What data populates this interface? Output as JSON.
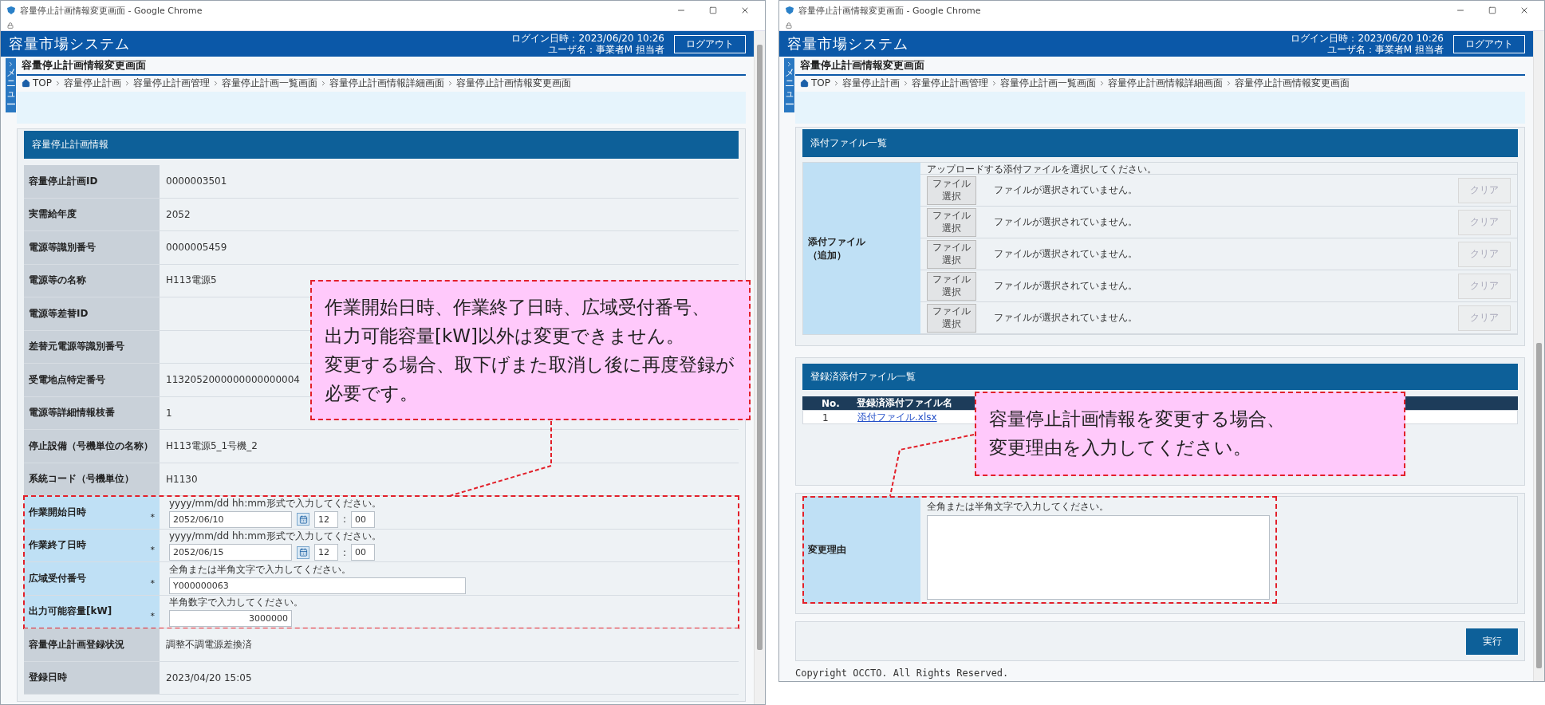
{
  "windows": [
    {
      "title": "容量停止計画情報変更画面 - Google Chrome",
      "app_name": "容量市場システム",
      "login_time": "ログイン日時：2023/06/20 10:26",
      "user_name": "ユーザ名：事業者M 担当者",
      "logout": "ログアウト",
      "menu_tab": "メニュー",
      "page_title": "容量停止計画情報変更画面",
      "breadcrumb": [
        "TOP",
        "容量停止計画",
        "容量停止計画管理",
        "容量停止計画一覧画面",
        "容量停止計画情報詳細画面",
        "容量停止計画情報変更画面"
      ],
      "sections": [
        {
          "kind": "details",
          "title": "容量停止計画情報",
          "rows": [
            {
              "kind": "text",
              "label": "容量停止計画ID",
              "value": "0000003501",
              "highlighted": false
            },
            {
              "kind": "text",
              "label": "実需給年度",
              "value": "2052",
              "highlighted": false
            },
            {
              "kind": "text",
              "label": "電源等識別番号",
              "value": "0000005459",
              "highlighted": false
            },
            {
              "kind": "text",
              "label": "電源等の名称",
              "value": "H113電源5",
              "highlighted": false
            },
            {
              "kind": "text",
              "label": "電源等差替ID",
              "highlighted": false
            },
            {
              "kind": "text",
              "label": "差替元電源等識別番号",
              "highlighted": false
            },
            {
              "kind": "text",
              "label": "受電地点特定番号",
              "value": "1132052000000000000004",
              "highlighted": false
            },
            {
              "kind": "text",
              "label": "電源等詳細情報枝番",
              "value": "1",
              "highlighted": false
            },
            {
              "kind": "text",
              "label": "停止設備（号機単位の名称）",
              "value": "H113電源5_1号機_2",
              "highlighted": false
            },
            {
              "kind": "text",
              "label": "系統コード（号機単位）",
              "value": "H1130",
              "highlighted": false
            },
            {
              "kind": "datetime",
              "label": "作業開始日時",
              "mark": "*",
              "hint": "yyyy/mm/dd hh:mm形式で入力してください。",
              "date": "2052/06/10",
              "hour": "12",
              "time_separator": ":",
              "minute": "00",
              "highlighted": true
            },
            {
              "kind": "datetime",
              "label": "作業終了日時",
              "mark": "*",
              "hint": "yyyy/mm/dd hh:mm形式で入力してください。",
              "date": "2052/06/15",
              "hour": "12",
              "time_separator": ":",
              "minute": "00",
              "highlighted": true
            },
            {
              "kind": "text_input",
              "label": "広域受付番号",
              "mark": "*",
              "hint": "全角または半角文字で入力してください。",
              "value": "Y000000063",
              "highlighted": true
            },
            {
              "kind": "number_input",
              "label": "出力可能容量[kW]",
              "mark": "*",
              "hint": "半角数字で入力してください。",
              "value": "3000000",
              "highlighted": true
            },
            {
              "kind": "text",
              "label": "容量停止計画登録状況",
              "value": "調整不調電源差換済",
              "highlighted": false
            },
            {
              "kind": "text",
              "label": "登録日時",
              "value": "2023/04/20 15:05",
              "highlighted": false
            }
          ]
        }
      ],
      "callout": [
        "作業開始日時、作業終了日時、広域受付番号、",
        "出力可能容量[kW]以外は変更できません。",
        "変更する場合、取下げまた取消し後に再度登録が",
        "必要です。"
      ]
    },
    {
      "title": "容量停止計画情報変更画面 - Google Chrome",
      "app_name": "容量市場システム",
      "login_time": "ログイン日時：2023/06/20 10:26",
      "user_name": "ユーザ名：事業者M 担当者",
      "logout": "ログアウト",
      "menu_tab": "メニュー",
      "page_title": "容量停止計画情報変更画面",
      "breadcrumb": [
        "TOP",
        "容量停止計画",
        "容量停止計画管理",
        "容量停止計画一覧画面",
        "容量停止計画情報詳細画面",
        "容量停止計画情報変更画面"
      ],
      "sections": [
        {
          "kind": "attachments",
          "title": "添付ファイル一覧",
          "label": "添付ファイル（追加）",
          "hint": "アップロードする添付ファイルを選択してください。",
          "files": [
            {
              "button": "ファイル選択",
              "status": "ファイルが選択されていません。",
              "clear": "クリア",
              "disabled": true
            },
            {
              "button": "ファイル選択",
              "status": "ファイルが選択されていません。",
              "clear": "クリア",
              "disabled": true
            },
            {
              "button": "ファイル選択",
              "status": "ファイルが選択されていません。",
              "clear": "クリア",
              "disabled": true
            },
            {
              "button": "ファイル選択",
              "status": "ファイルが選択されていません。",
              "clear": "クリア",
              "disabled": true
            },
            {
              "button": "ファイル選択",
              "status": "ファイルが選択されていません。",
              "clear": "クリア",
              "disabled": true
            }
          ]
        },
        {
          "kind": "registered_files",
          "title": "登録済添付ファイル一覧",
          "columns": [
            "No.",
            "登録済添付ファイル名"
          ],
          "rows": [
            {
              "no": "1",
              "file": "添付ファイル.xlsx"
            }
          ]
        },
        {
          "kind": "reason",
          "label": "変更理由",
          "hint": "全角または半角文字で入力してください。",
          "highlighted": true
        },
        {
          "kind": "actions",
          "button": "実行"
        }
      ],
      "copyright": "Copyright OCCTO. All Rights Reserved.",
      "callout": [
        "容量停止計画情報を変更する場合、",
        "変更理由を入力してください。"
      ]
    }
  ]
}
